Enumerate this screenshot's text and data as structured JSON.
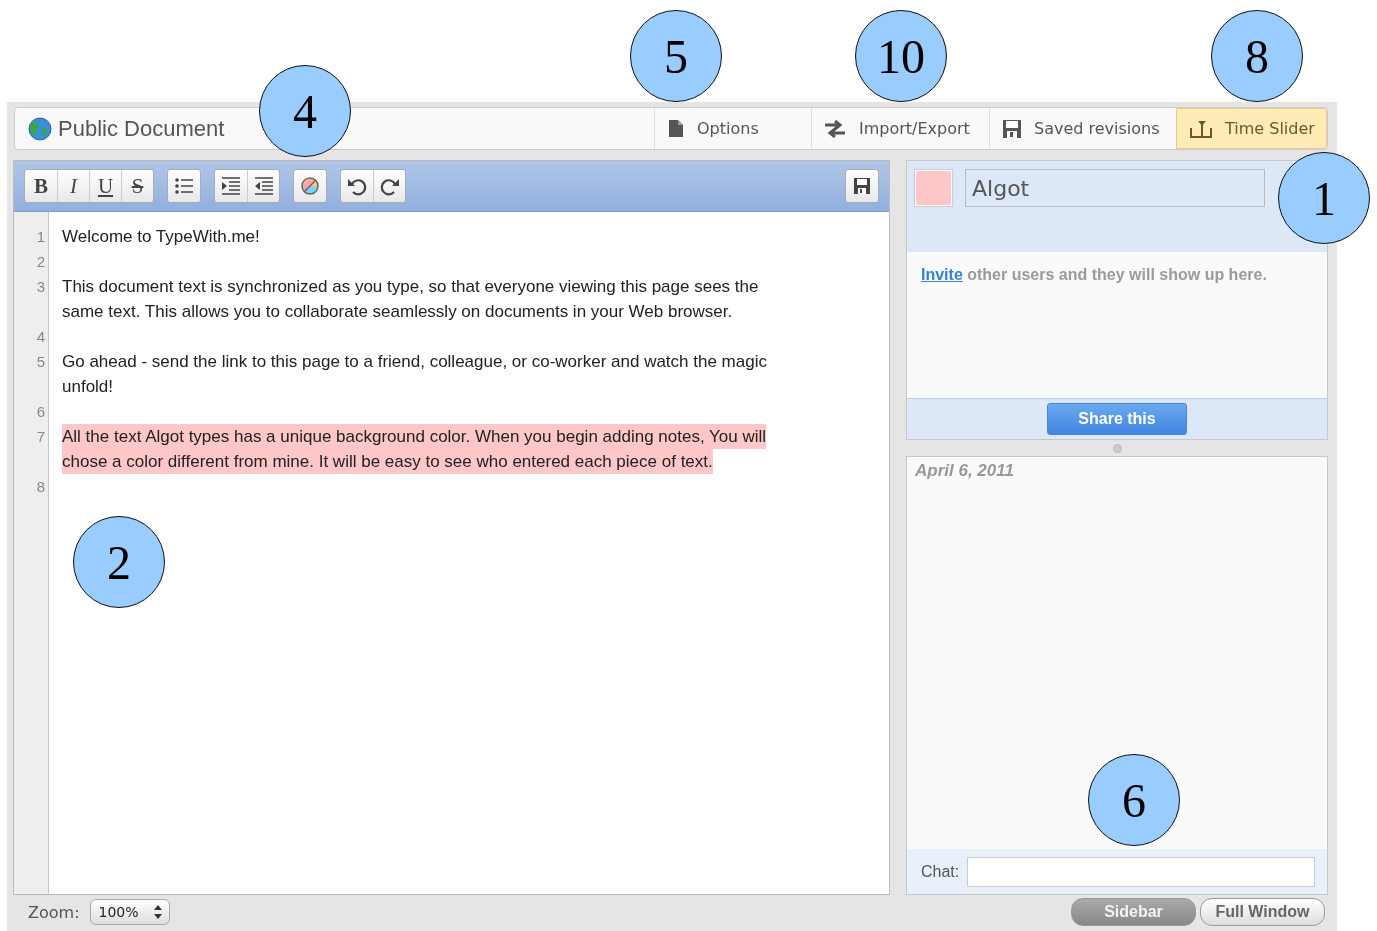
{
  "document": {
    "title": "Public Document"
  },
  "tabs": [
    {
      "label": "Options",
      "selected": false
    },
    {
      "label": "Import/Export",
      "selected": false
    },
    {
      "label": "Saved revisions",
      "selected": false
    },
    {
      "label": "Time Slider",
      "selected": true
    }
  ],
  "toolbar": {
    "format_buttons": [
      "B",
      "I",
      "U",
      "S"
    ]
  },
  "lines": [
    {
      "number": "1",
      "text": "Welcome to TypeWith.me!"
    },
    {
      "number": "2"
    },
    {
      "number": "3",
      "rows": [
        "This document text is synchronized as you type, so that everyone viewing this page sees the",
        "same text. This allows you to collaborate seamlessly on documents in your Web browser."
      ]
    },
    {
      "number": "4"
    },
    {
      "number": "5",
      "rows": [
        "Go ahead - send the link to this page to a friend, colleague, or co-worker and watch the magic",
        "unfold!"
      ]
    },
    {
      "number": "6"
    },
    {
      "number": "7",
      "rows": [
        "All the text Algot types has a unique background color. When you begin adding notes, You will",
        "chose a color different from mine. It will be easy to see who entered each piece of text."
      ],
      "color": "#ffc7c7"
    },
    {
      "number": "8"
    }
  ],
  "users": {
    "me": {
      "name": "Algot",
      "color": "#ffc7c7"
    },
    "invite_link": "Invite",
    "invite_text": "other users and they will show up here.",
    "share_button": "Share this"
  },
  "chat": {
    "date": "April 6, 2011",
    "label": "Chat:"
  },
  "footer": {
    "zoom_label": "Zoom:",
    "zoom_value": "100%",
    "view_buttons": [
      {
        "label": "Sidebar",
        "selected": true
      },
      {
        "label": "Full Window",
        "selected": false
      }
    ]
  },
  "callouts": [
    {
      "label": "4"
    },
    {
      "label": "5"
    },
    {
      "label": "10"
    },
    {
      "label": "8"
    },
    {
      "label": "1"
    },
    {
      "label": "2"
    },
    {
      "label": "6"
    }
  ]
}
